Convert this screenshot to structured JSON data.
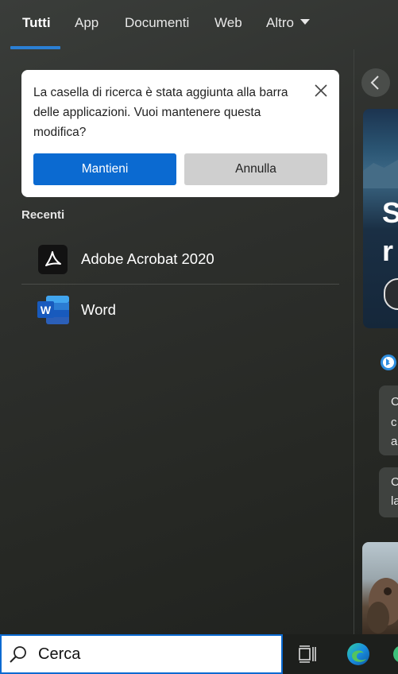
{
  "tabs": [
    {
      "label": "Tutti",
      "active": true
    },
    {
      "label": "App"
    },
    {
      "label": "Documenti"
    },
    {
      "label": "Web"
    },
    {
      "label": "Altro"
    }
  ],
  "dialog": {
    "message": "La casella di ricerca è stata aggiunta alla barra delle applicazioni. Vuoi mantenere questa modifica?",
    "keep_label": "Mantieni",
    "cancel_label": "Annulla"
  },
  "recent": {
    "heading": "Recenti",
    "items": [
      {
        "label": "Adobe Acrobat 2020",
        "icon": "adobe-acrobat-icon"
      },
      {
        "label": "Word",
        "icon": "word-icon"
      }
    ]
  },
  "right_panel": {
    "hero_text_1": "S",
    "hero_text_2": "r",
    "chip1": [
      "C",
      "c",
      "a"
    ],
    "chip2": [
      "C",
      "la"
    ]
  },
  "taskbar": {
    "search_value": "Cerca",
    "search_placeholder": "Cerca"
  },
  "colors": {
    "accent": "#0b6ad1",
    "tab_underline": "#2b7fd4"
  }
}
